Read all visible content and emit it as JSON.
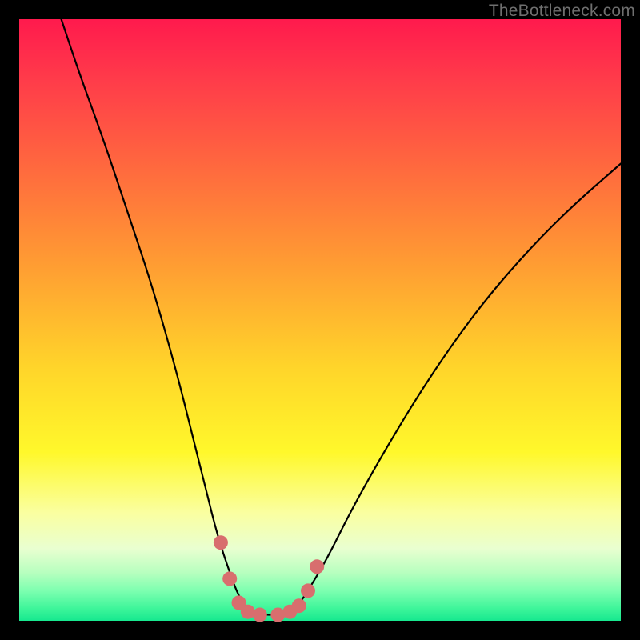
{
  "attribution": "TheBottleneck.com",
  "chart_data": {
    "type": "line",
    "title": "",
    "xlabel": "",
    "ylabel": "",
    "xlim": [
      0,
      100
    ],
    "ylim": [
      0,
      100
    ],
    "series": [
      {
        "name": "bottleneck-curve",
        "color": "#000000",
        "x": [
          7,
          10,
          14,
          18,
          22,
          26,
          29,
          31,
          33,
          35,
          36.5,
          38,
          40,
          43,
          46,
          48,
          51,
          55,
          60,
          66,
          72,
          78,
          85,
          92,
          100
        ],
        "y": [
          100,
          91,
          80,
          68,
          56,
          42,
          30,
          22,
          14,
          8,
          4,
          2,
          1,
          1,
          2,
          5,
          10,
          18,
          27,
          37,
          46,
          54,
          62,
          69,
          76
        ]
      },
      {
        "name": "sweet-spot-markers",
        "color": "#d86e6e",
        "type": "scatter",
        "x": [
          33.5,
          35,
          36.5,
          38,
          40,
          43,
          45,
          46.5,
          48,
          49.5
        ],
        "y": [
          13,
          7,
          3,
          1.5,
          1,
          1,
          1.5,
          2.5,
          5,
          9
        ]
      }
    ],
    "background_gradient": {
      "top": "#ff1a4d",
      "mid_high": "#ff9a33",
      "mid": "#fff82b",
      "low": "#16e88f"
    }
  }
}
